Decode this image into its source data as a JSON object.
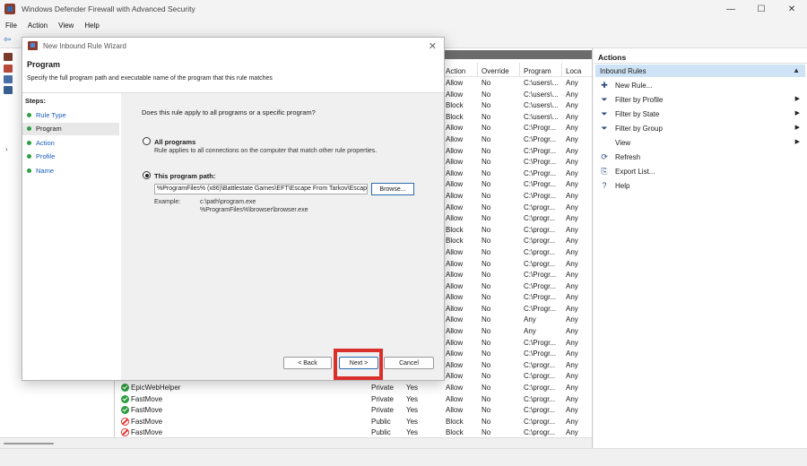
{
  "window": {
    "title": "Windows Defender Firewall with Advanced Security",
    "controls": [
      "—",
      "☐",
      "✕"
    ]
  },
  "menu": [
    "File",
    "Action",
    "View",
    "Help"
  ],
  "rules_table": {
    "columns": [
      "Action",
      "Override",
      "Program",
      "Loca"
    ],
    "rows_upper": [
      {
        "action": "Allow",
        "override": "No",
        "program": "C:\\users\\...",
        "loc": "Any"
      },
      {
        "action": "Allow",
        "override": "No",
        "program": "C:\\users\\...",
        "loc": "Any"
      },
      {
        "action": "Block",
        "override": "No",
        "program": "C:\\users\\...",
        "loc": "Any"
      },
      {
        "action": "Block",
        "override": "No",
        "program": "C:\\users\\...",
        "loc": "Any"
      },
      {
        "action": "Allow",
        "override": "No",
        "program": "C:\\Progr...",
        "loc": "Any"
      },
      {
        "action": "Allow",
        "override": "No",
        "program": "C:\\Progr...",
        "loc": "Any"
      },
      {
        "action": "Allow",
        "override": "No",
        "program": "C:\\Progr...",
        "loc": "Any"
      },
      {
        "action": "Allow",
        "override": "No",
        "program": "C:\\Progr...",
        "loc": "Any"
      },
      {
        "action": "Allow",
        "override": "No",
        "program": "C:\\Progr...",
        "loc": "Any"
      },
      {
        "action": "Allow",
        "override": "No",
        "program": "C:\\Progr...",
        "loc": "Any"
      },
      {
        "action": "Allow",
        "override": "No",
        "program": "C:\\Progr...",
        "loc": "Any"
      },
      {
        "action": "Allow",
        "override": "No",
        "program": "C:\\progr...",
        "loc": "Any"
      },
      {
        "action": "Allow",
        "override": "No",
        "program": "C:\\progr...",
        "loc": "Any"
      },
      {
        "action": "Block",
        "override": "No",
        "program": "C:\\progr...",
        "loc": "Any"
      },
      {
        "action": "Block",
        "override": "No",
        "program": "C:\\progr...",
        "loc": "Any"
      },
      {
        "action": "Allow",
        "override": "No",
        "program": "C:\\progr...",
        "loc": "Any"
      },
      {
        "action": "Allow",
        "override": "No",
        "program": "C:\\progr...",
        "loc": "Any"
      },
      {
        "action": "Allow",
        "override": "No",
        "program": "C:\\Progr...",
        "loc": "Any"
      },
      {
        "action": "Allow",
        "override": "No",
        "program": "C:\\Progr...",
        "loc": "Any"
      },
      {
        "action": "Allow",
        "override": "No",
        "program": "C:\\Progr...",
        "loc": "Any"
      },
      {
        "action": "Allow",
        "override": "No",
        "program": "C:\\Progr...",
        "loc": "Any"
      },
      {
        "action": "Allow",
        "override": "No",
        "program": "Any",
        "loc": "Any"
      },
      {
        "action": "Allow",
        "override": "No",
        "program": "Any",
        "loc": "Any"
      },
      {
        "action": "Allow",
        "override": "No",
        "program": "C:\\Progr...",
        "loc": "Any"
      },
      {
        "action": "Allow",
        "override": "No",
        "program": "C:\\Progr...",
        "loc": "Any"
      },
      {
        "action": "Allow",
        "override": "No",
        "program": "C:\\progr...",
        "loc": "Any"
      },
      {
        "action": "Allow",
        "override": "No",
        "program": "C:\\progr...",
        "loc": "Any"
      }
    ],
    "rows_lower": [
      {
        "name": "EpicWebHelper",
        "profile": "Private",
        "enabled": "Yes",
        "action": "Allow",
        "override": "No",
        "program": "C:\\progr...",
        "loc": "Any",
        "status": "allow"
      },
      {
        "name": "FastMove",
        "profile": "Private",
        "enabled": "Yes",
        "action": "Allow",
        "override": "No",
        "program": "C:\\progr...",
        "loc": "Any",
        "status": "allow"
      },
      {
        "name": "FastMove",
        "profile": "Private",
        "enabled": "Yes",
        "action": "Allow",
        "override": "No",
        "program": "C:\\progr...",
        "loc": "Any",
        "status": "allow"
      },
      {
        "name": "FastMove",
        "profile": "Public",
        "enabled": "Yes",
        "action": "Block",
        "override": "No",
        "program": "C:\\progr...",
        "loc": "Any",
        "status": "block"
      },
      {
        "name": "FastMove",
        "profile": "Public",
        "enabled": "Yes",
        "action": "Block",
        "override": "No",
        "program": "C:\\progr...",
        "loc": "Any",
        "status": "block"
      }
    ]
  },
  "actions_pane": {
    "title": "Actions",
    "section": "Inbound Rules",
    "items": [
      {
        "label": "New Rule...",
        "icon": "new-rule-icon",
        "glyph": "✚",
        "submenu": false
      },
      {
        "label": "Filter by Profile",
        "icon": "filter-icon",
        "glyph": "⏷",
        "submenu": true
      },
      {
        "label": "Filter by State",
        "icon": "filter-icon",
        "glyph": "⏷",
        "submenu": true
      },
      {
        "label": "Filter by Group",
        "icon": "filter-icon",
        "glyph": "⏷",
        "submenu": true
      },
      {
        "label": "View",
        "icon": "",
        "glyph": "",
        "submenu": true
      },
      {
        "label": "Refresh",
        "icon": "refresh-icon",
        "glyph": "⟳",
        "submenu": false
      },
      {
        "label": "Export List...",
        "icon": "export-icon",
        "glyph": "⎘",
        "submenu": false
      },
      {
        "label": "Help",
        "icon": "help-icon",
        "glyph": "?",
        "submenu": false
      }
    ]
  },
  "wizard": {
    "title": "New Inbound Rule Wizard",
    "header_title": "Program",
    "header_subtitle": "Specify the full program path and executable name of the program that this rule matches",
    "steps_label": "Steps:",
    "steps": [
      "Rule Type",
      "Program",
      "Action",
      "Profile",
      "Name"
    ],
    "active_step": 1,
    "question": "Does this rule apply to all programs or a specific program?",
    "option_all": "All programs",
    "option_all_desc": "Rule applies to all connections on the computer that match other rule properties.",
    "option_path": "This program path:",
    "path_value": "%ProgramFiles% (x86)\\Battlestate Games\\EFT\\Escape From Tarkov\\Escap",
    "browse_label": "Browse...",
    "example_label": "Example:",
    "example_line1": "c:\\path\\program.exe",
    "example_line2": "%ProgramFiles%\\browser\\browser.exe",
    "back_label": "< Back",
    "next_label": "Next >",
    "cancel_label": "Cancel",
    "highlight_color": "#d9302c"
  }
}
